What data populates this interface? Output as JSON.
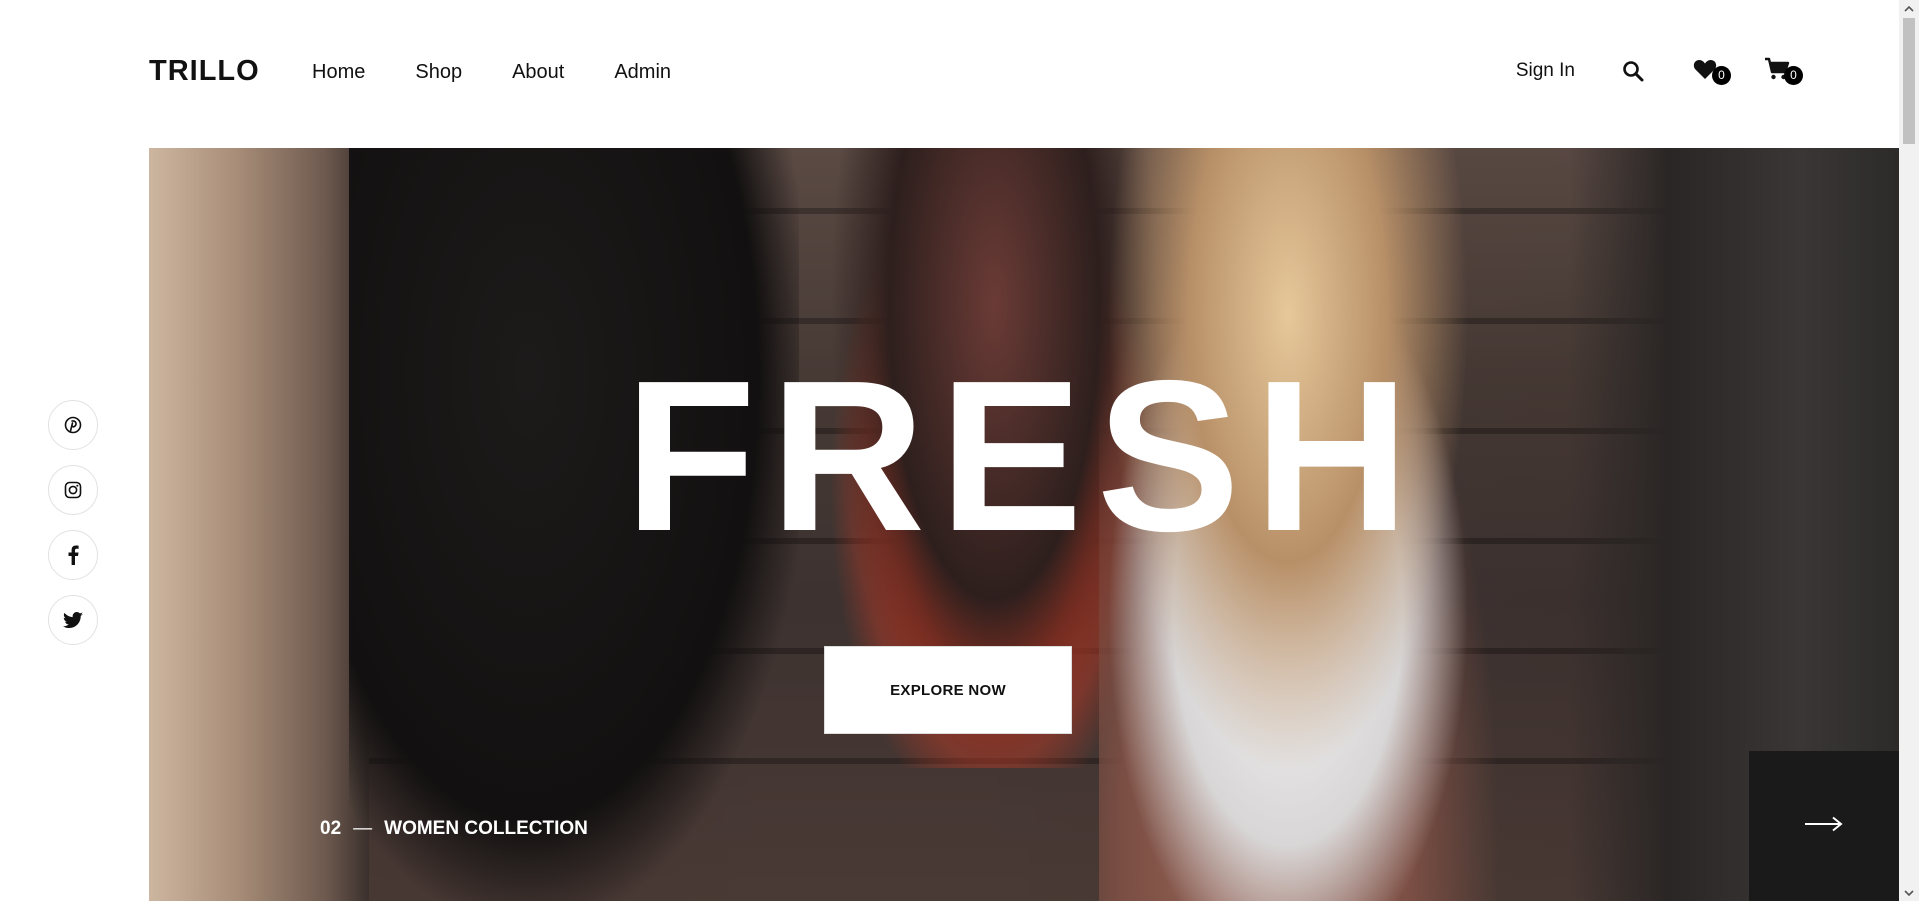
{
  "header": {
    "logo": "TRILLO",
    "nav": [
      {
        "label": "Home"
      },
      {
        "label": "Shop"
      },
      {
        "label": "About"
      },
      {
        "label": "Admin"
      }
    ],
    "sign_in": "Sign In",
    "wishlist_count": "0",
    "cart_count": "0",
    "icons": [
      "search-icon",
      "heart-icon",
      "cart-icon"
    ]
  },
  "social": [
    "pinterest-icon",
    "instagram-icon",
    "facebook-icon",
    "twitter-icon"
  ],
  "hero": {
    "title": "FRESH",
    "cta": "EXPLORE NOW",
    "collection_number": "02",
    "collection_dash": "—",
    "collection_label": "WOMEN COLLECTION",
    "next_icon": "arrow-right-icon"
  },
  "colors": {
    "text": "#111111",
    "badge": "#000000",
    "next_button": "#1a1a1a",
    "hero_title": "#ffffff"
  }
}
